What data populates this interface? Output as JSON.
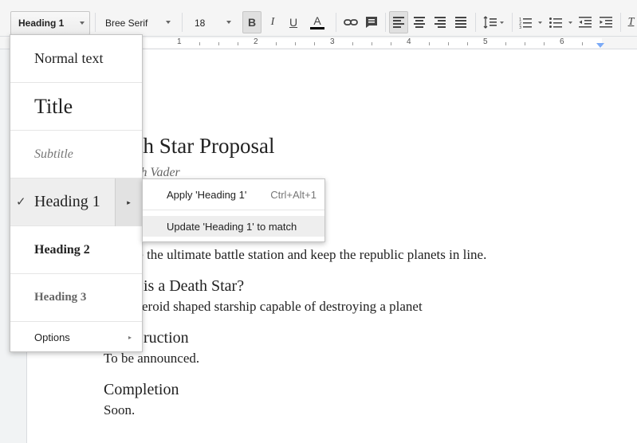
{
  "toolbar": {
    "style_value": "Heading 1",
    "font_value": "Bree Serif",
    "size_value": "18",
    "bold_label": "B",
    "italic_label": "I",
    "underline_label": "U",
    "text_color_label": "A",
    "text_color": "#000000"
  },
  "ruler": {
    "numbers": [
      "1",
      "2",
      "3",
      "4",
      "5",
      "6"
    ]
  },
  "document": {
    "title": "th Star Proposal",
    "author": "th Vader",
    "body_line1": "ate the ultimate battle station and keep the republic planets in line.",
    "heading_what": "is a Death Star?",
    "body_what": "eroid shaped starship capable of destroying a planet",
    "heading_construction": "ruction",
    "body_construction": "To be announced.",
    "heading_completion": "Completion",
    "body_completion": "Soon."
  },
  "style_menu": {
    "normal_text": "Normal text",
    "title": "Title",
    "subtitle": "Subtitle",
    "heading1": "Heading 1",
    "heading2": "Heading 2",
    "heading3": "Heading 3",
    "options": "Options",
    "check_mark": "✓",
    "submenu_arrow": "▸",
    "options_arrow": "▸"
  },
  "submenu": {
    "apply_label": "Apply 'Heading 1'",
    "apply_shortcut": "Ctrl+Alt+1",
    "update_label": "Update 'Heading 1' to match"
  }
}
